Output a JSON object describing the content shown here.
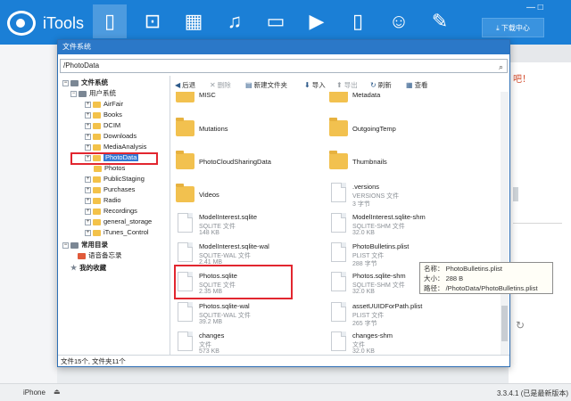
{
  "app": {
    "logo_text": "iTools",
    "download_label": "下载中心",
    "nav_icons": [
      "phone-icon",
      "app-store-icon",
      "grid-icon",
      "music-icon",
      "photo-icon",
      "video-icon",
      "book-icon",
      "user-icon",
      "wrench-icon"
    ],
    "accent": "#1b7fd6"
  },
  "background": {
    "right_text": "吧！",
    "refresh_glyph": "↻"
  },
  "dialog": {
    "title": "文件系统",
    "path": "/PhotoData",
    "footer": "文件15个, 文件夹11个"
  },
  "toolbar": {
    "back": "后退",
    "delete": "删除",
    "new_folder": "新建文件夹",
    "import": "导入",
    "export": "导出",
    "refresh": "刷新",
    "view": "查看"
  },
  "tree": {
    "root": "文件系统",
    "user": "用户系统",
    "folders": [
      "AirFair",
      "Books",
      "DCIM",
      "Downloads",
      "MediaAnalysis",
      "PhotoData",
      "Photos",
      "PublicStaging",
      "Purchases",
      "Radio",
      "Recordings",
      "general_storage",
      "iTunes_Control"
    ],
    "common": "常用目录",
    "voice_memo": "语音备忘录",
    "favorites": "我的收藏"
  },
  "files": [
    {
      "name": "MISC",
      "type": "",
      "size": "",
      "kind": "folder"
    },
    {
      "name": "Metadata",
      "type": "",
      "size": "",
      "kind": "folder"
    },
    {
      "name": "Mutations",
      "type": "",
      "size": "",
      "kind": "folder"
    },
    {
      "name": "OutgoingTemp",
      "type": "",
      "size": "",
      "kind": "folder"
    },
    {
      "name": "PhotoCloudSharingData",
      "type": "",
      "size": "",
      "kind": "folder"
    },
    {
      "name": "Thumbnails",
      "type": "",
      "size": "",
      "kind": "folder"
    },
    {
      "name": "Videos",
      "type": "",
      "size": "",
      "kind": "folder"
    },
    {
      "name": ".versions",
      "type": "VERSIONS 文件",
      "size": "3 字节",
      "kind": "doc"
    },
    {
      "name": "ModelInterest.sqlite",
      "type": "SQLITE 文件",
      "size": "148 KB",
      "kind": "doc"
    },
    {
      "name": "ModelInterest.sqlite-shm",
      "type": "SQLITE-SHM 文件",
      "size": "32.0 KB",
      "kind": "doc"
    },
    {
      "name": "ModelInterest.sqlite-wal",
      "type": "SQLITE-WAL 文件",
      "size": "2.41 MB",
      "kind": "doc"
    },
    {
      "name": "PhotoBulletins.plist",
      "type": "PLIST 文件",
      "size": "288 字节",
      "kind": "doc"
    },
    {
      "name": "Photos.sqlite",
      "type": "SQLITE 文件",
      "size": "2.35 MB",
      "kind": "doc"
    },
    {
      "name": "Photos.sqlite-shm",
      "type": "SQLITE-SHM 文件",
      "size": "32.0 KB",
      "kind": "doc"
    },
    {
      "name": "Photos.sqlite-wal",
      "type": "SQLITE-WAL 文件",
      "size": "39.2 MB",
      "kind": "doc"
    },
    {
      "name": "assetUUIDForPath.plist",
      "type": "PLIST 文件",
      "size": "265 字节",
      "kind": "doc"
    },
    {
      "name": "changes",
      "type": "文件",
      "size": "573 KB",
      "kind": "doc"
    },
    {
      "name": "changes-shm",
      "type": "文件",
      "size": "32.0 KB",
      "kind": "doc"
    }
  ],
  "tooltip": {
    "name": "名称： PhotoBulletins.plist",
    "size": "大小： 288 B",
    "path": "路径： /PhotoData/PhotoBulletins.plist"
  },
  "statusbar": {
    "device": "iPhone",
    "eject": "⏏",
    "version": "3.3.4.1 (已是最新版本)"
  }
}
